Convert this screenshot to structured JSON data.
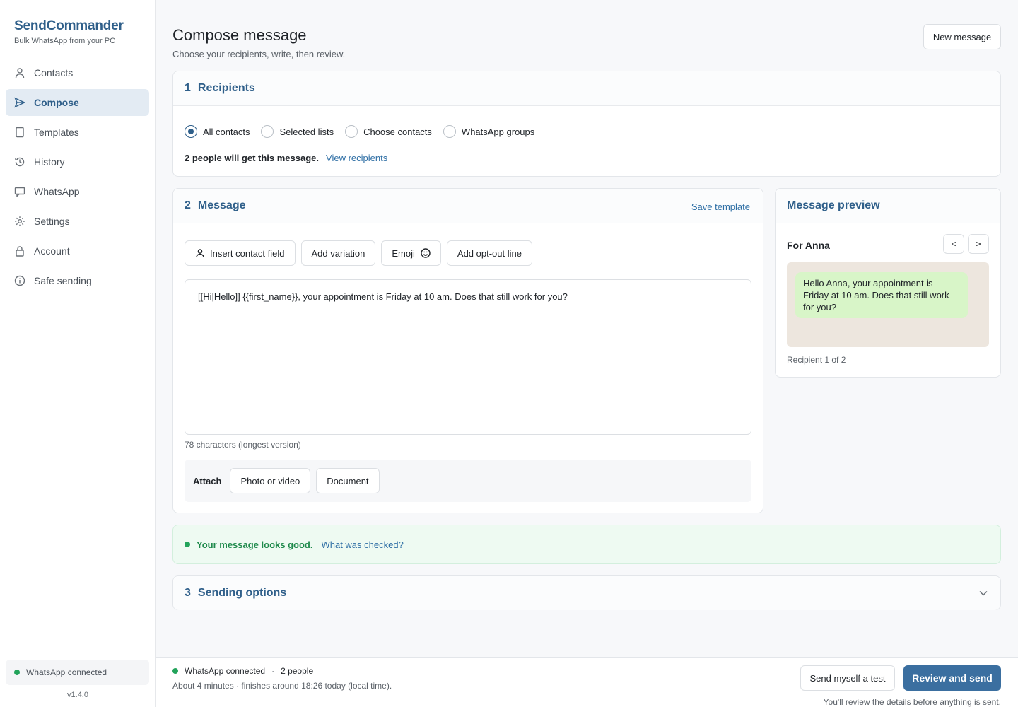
{
  "brand": {
    "name": "SendCommander",
    "tagline": "Bulk WhatsApp from your PC"
  },
  "nav": [
    {
      "label": "Contacts",
      "icon": "user-icon"
    },
    {
      "label": "Compose",
      "icon": "send-icon",
      "active": true
    },
    {
      "label": "Templates",
      "icon": "page-icon"
    },
    {
      "label": "History",
      "icon": "history-icon"
    },
    {
      "label": "WhatsApp",
      "icon": "chat-icon"
    },
    {
      "label": "Settings",
      "icon": "gear-icon"
    },
    {
      "label": "Account",
      "icon": "lock-icon"
    },
    {
      "label": "Safe sending",
      "icon": "info-icon"
    }
  ],
  "sidebar_status": "WhatsApp connected",
  "version": "v1.4.0",
  "header": {
    "title": "Compose message",
    "subtitle": "Choose your recipients, write, then review.",
    "new_message": "New message"
  },
  "recipients": {
    "step": "1",
    "title": "Recipients",
    "options": [
      "All contacts",
      "Selected lists",
      "Choose contacts",
      "WhatsApp groups"
    ],
    "selected": "All contacts",
    "summary": "2 people will get this message.",
    "view_link": "View recipients"
  },
  "message": {
    "step": "2",
    "title": "Message",
    "save_template": "Save template",
    "toolbar": {
      "insert_field": "Insert contact field",
      "add_variation": "Add variation",
      "emoji": "Emoji",
      "opt_out": "Add opt-out line"
    },
    "body": "[[Hi|Hello]] {{first_name}}, your appointment is Friday at 10 am. Does that still work for you?",
    "char_count": "78 characters (longest version)",
    "attach": {
      "label": "Attach",
      "photo": "Photo or video",
      "document": "Document"
    }
  },
  "preview": {
    "title": "Message preview",
    "for_label": "For Anna",
    "prev": "<",
    "next": ">",
    "bubble": "Hello Anna, your appointment is Friday at 10 am. Does that still work for you?",
    "footer": "Recipient 1 of 2"
  },
  "check": {
    "text": "Your message looks good.",
    "link": "What was checked?"
  },
  "sending_options": {
    "step": "3",
    "title": "Sending options"
  },
  "footer": {
    "status": "WhatsApp connected",
    "separator": "·",
    "people": "2 people",
    "estimate": "About 4 minutes · finishes around 18:26 today (local time).",
    "test_button": "Send myself a test",
    "send_button": "Review and send",
    "note": "You'll review the details before anything is sent."
  },
  "colors": {
    "brand": "#2f5f8a",
    "primary_button": "#3b6fa0",
    "success": "#22a35a",
    "chat_bg": "#ede6de",
    "bubble": "#d8f5c8"
  }
}
